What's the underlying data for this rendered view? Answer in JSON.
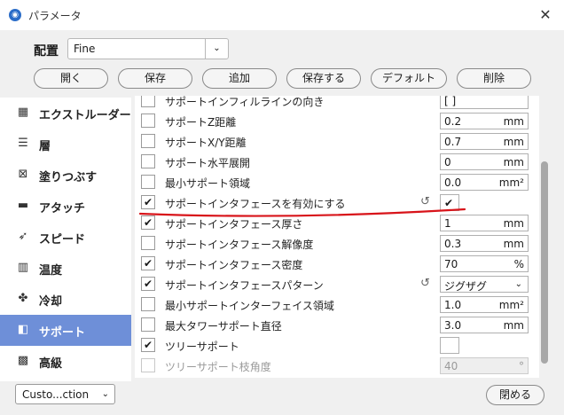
{
  "window": {
    "title": "パラメータ",
    "close_glyph": "✕"
  },
  "preset": {
    "label": "配置",
    "value": "Fine",
    "arrow": "⌄"
  },
  "toolbar": {
    "open": "開く",
    "save": "保存",
    "add": "追加",
    "save_as": "保存する",
    "default": "デフォルト",
    "delete": "削除"
  },
  "sidebar": {
    "items": [
      {
        "label": "エクストルーダー",
        "icon": "extruder-icon",
        "glyph": "▦"
      },
      {
        "label": "層",
        "icon": "layer-icon",
        "glyph": "☰"
      },
      {
        "label": "塗りつぶす",
        "icon": "infill-icon",
        "glyph": "⊠"
      },
      {
        "label": "アタッチ",
        "icon": "briefcase-icon",
        "glyph": "▬"
      },
      {
        "label": "スピード",
        "icon": "rocket-icon",
        "glyph": "➶"
      },
      {
        "label": "温度",
        "icon": "temperature-icon",
        "glyph": "▥"
      },
      {
        "label": "冷却",
        "icon": "fan-icon",
        "glyph": "✤"
      },
      {
        "label": "サポート",
        "icon": "support-icon",
        "glyph": "◧",
        "active": true
      },
      {
        "label": "高級",
        "icon": "advanced-icon",
        "glyph": "▩"
      }
    ]
  },
  "settings": {
    "rows": [
      {
        "label": "サポートインフィルラインの向き",
        "value": "[ ]",
        "unit": ""
      },
      {
        "label": "サポートZ距離",
        "value": "0.2",
        "unit": "mm"
      },
      {
        "label": "サポートX/Y距離",
        "value": "0.7",
        "unit": "mm"
      },
      {
        "label": "サポート水平展開",
        "value": "0",
        "unit": "mm"
      },
      {
        "label": "最小サポート領域",
        "value": "0.0",
        "unit": "mm²"
      },
      {
        "label": "サポートインタフェースを有効にする",
        "checked_glyph": "✔",
        "value_glyph": "✔"
      },
      {
        "label": "サポートインタフェース厚さ",
        "value": "1",
        "unit": "mm"
      },
      {
        "label": "サポートインタフェース解像度",
        "value": "0.3",
        "unit": "mm"
      },
      {
        "label": "サポートインタフェース密度",
        "value": "70",
        "unit": "%"
      },
      {
        "label": "サポートインタフェースパターン",
        "value": "ジグザグ",
        "unit": "⌄"
      },
      {
        "label": "最小サポートインターフェイス領域",
        "value": "1.0",
        "unit": "mm²"
      },
      {
        "label": "最大タワーサポート直径",
        "value": "3.0",
        "unit": "mm"
      },
      {
        "label": "ツリーサポート",
        "value": ""
      },
      {
        "label": "ツリーサポート枝角度",
        "value": "40",
        "unit": "°"
      }
    ],
    "check_glyph": "✔",
    "reset_glyph": "↺"
  },
  "footer": {
    "mode_value": "Custo...ction",
    "mode_arrow": "⌄",
    "close_label": "閉める"
  },
  "colors": {
    "accent": "#6e8fd8",
    "annotation": "#d8141a",
    "brand": "#2a6cc8"
  }
}
